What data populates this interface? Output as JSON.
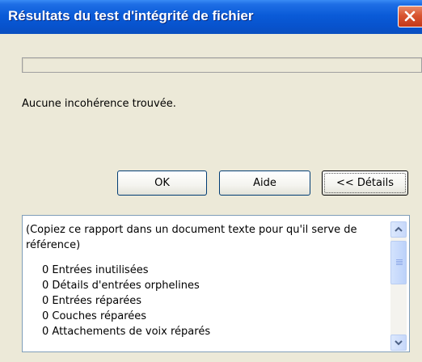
{
  "window": {
    "title": "Résultats du test d'intégrité de fichier"
  },
  "status": {
    "message": "Aucune incohérence trouvée."
  },
  "progress": {
    "fraction": 0
  },
  "buttons": {
    "ok_label": "OK",
    "help_label": "Aide",
    "details_label": "<< Détails"
  },
  "report": {
    "intro": "(Copiez ce rapport dans un document texte pour qu'il serve de référence)",
    "lines": [
      "0 Entrées inutilisées",
      "0 Détails d'entrées orphelines",
      "0 Entrées réparées",
      "0 Couches réparées",
      "0 Attachements de voix réparés"
    ]
  },
  "icons": {
    "close": "close-icon",
    "scroll_up": "arrow-up-icon",
    "scroll_down": "arrow-down-icon"
  },
  "colors": {
    "titlebar": "#0a5bd8",
    "window_bg": "#ece9d8",
    "close_button": "#d85530",
    "input_border": "#7f9db9"
  }
}
